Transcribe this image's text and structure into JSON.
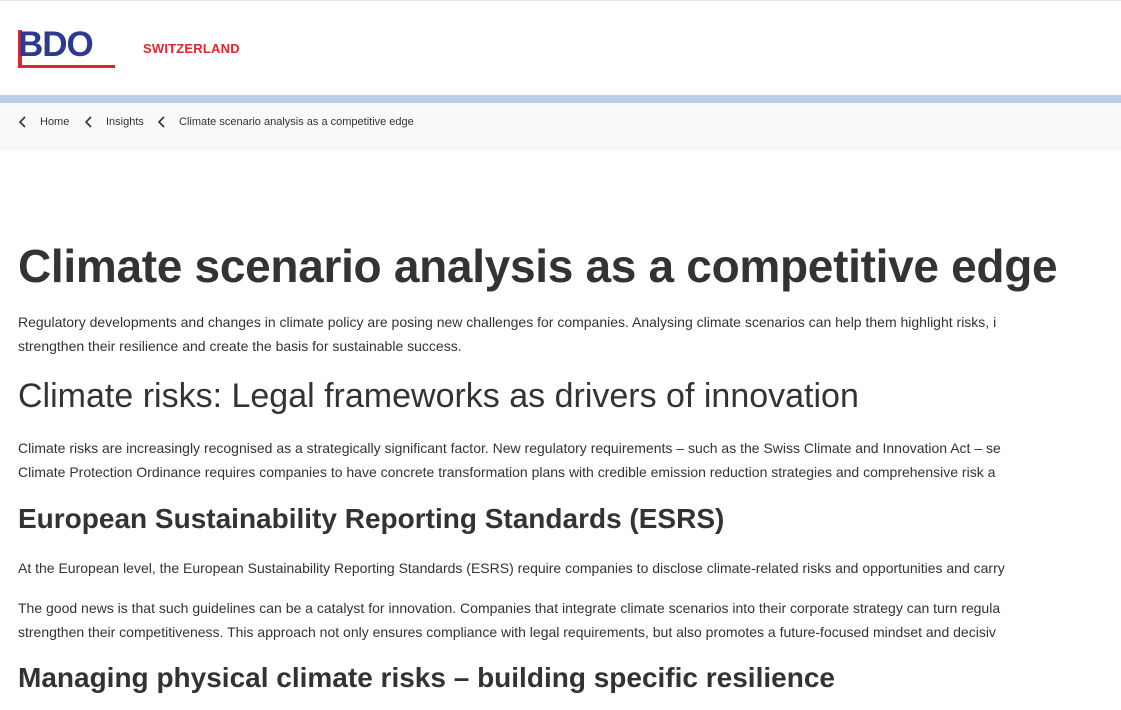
{
  "header": {
    "logo_text": "BDO",
    "country": "SWITZERLAND"
  },
  "breadcrumb": [
    {
      "label": "Home"
    },
    {
      "label": "Insights"
    },
    {
      "label": "Climate scenario analysis as a competitive edge"
    }
  ],
  "article": {
    "title": "Climate scenario analysis as a competitive edge",
    "intro_line1": "Regulatory developments and changes in climate policy are posing new challenges for companies. Analysing climate scenarios can help them highlight risks, i",
    "intro_line2": "strengthen their resilience and create the basis for sustainable success.",
    "section1_title": "Climate risks: Legal frameworks as drivers of innovation",
    "section1_line1": "Climate risks are increasingly recognised as a strategically significant factor. New regulatory requirements – such as the Swiss Climate and Innovation Act – se",
    "section1_line2": "Climate Protection Ordinance requires companies to have concrete transformation plans with credible emission reduction strategies and comprehensive risk a",
    "section2_title": "European Sustainability Reporting Standards (ESRS)",
    "section2_para1": "At the European level, the European Sustainability Reporting Standards (ESRS) require companies to disclose climate-related risks and opportunities and carry",
    "section2_para2_line1": "The good news is that such guidelines can be a catalyst for innovation. Companies that integrate climate scenarios into their corporate strategy can turn regula",
    "section2_para2_line2": "strengthen their competitiveness. This approach not only ensures compliance with legal requirements, but also promotes a future-focused mindset and decisiv",
    "section3_title": "Managing physical climate risks – building specific resilience"
  },
  "colors": {
    "brand_blue": "#2c3a8f",
    "brand_red": "#e1262d",
    "band_blue": "#b8d0ea"
  }
}
